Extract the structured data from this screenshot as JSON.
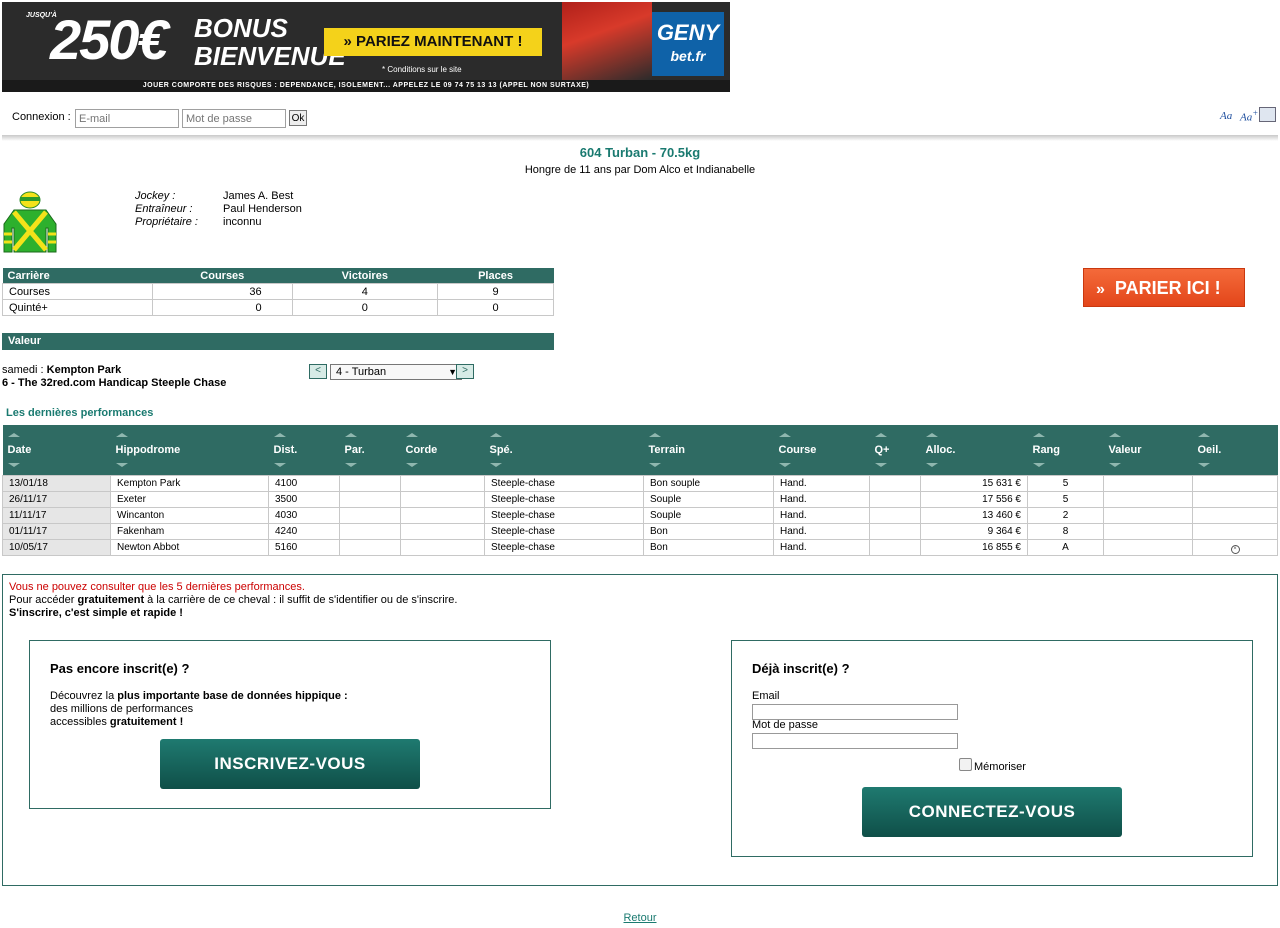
{
  "banner": {
    "prefix": "JUSQU'À",
    "amount": "250€",
    "headline": "BONUS BIENVENUE",
    "cta": "» PARIEZ MAINTENANT !",
    "conditions": "* Conditions sur le site",
    "brand_top": "GENY",
    "brand_bottom": "bet.fr",
    "footer": "JOUER COMPORTE DES RISQUES : DEPENDANCE, ISOLEMENT... APPELEZ LE 09 74 75 13 13 (APPEL NON SURTAXE)"
  },
  "login": {
    "label": "Connexion :",
    "email_placeholder": "E-mail",
    "password_placeholder": "Mot de passe",
    "ok": "Ok"
  },
  "tools": {
    "font_small": "Aa",
    "font_large": "Aa",
    "font_plus": "+"
  },
  "horse": {
    "title": "604 Turban  - 70.5kg",
    "subtitle": "Hongre de 11 ans par Dom Alco et Indianabelle"
  },
  "connections": {
    "jockey_label": "Jockey :",
    "jockey": "James A. Best",
    "trainer_label": "Entraîneur :",
    "trainer": "Paul Henderson",
    "owner_label": "Propriétaire :",
    "owner": "inconnu"
  },
  "career": {
    "headers": [
      "Carrière",
      "Courses",
      "Victoires",
      "Places"
    ],
    "rows": [
      [
        "Courses",
        "36",
        "4",
        "9"
      ],
      [
        "Quinté+",
        "0",
        "0",
        "0"
      ]
    ]
  },
  "valeur_label": "Valeur",
  "bet_button": "PARIER ICI !",
  "race": {
    "day": "samedi :",
    "venue": "Kempton Park",
    "name": "6 - The 32red.com Handicap Steeple Chase",
    "prev": "<",
    "next": ">",
    "selected_horse": "4 - Turban"
  },
  "perf": {
    "title": "Les dernières performances",
    "headers": [
      "Date",
      "Hippodrome",
      "Dist.",
      "Par.",
      "Corde",
      "Spé.",
      "Terrain",
      "Course",
      "Q+",
      "Alloc.",
      "Rang",
      "Valeur",
      "Oeil."
    ],
    "rows": [
      [
        "13/01/18",
        "Kempton Park",
        "4100",
        "",
        "",
        "Steeple-chase",
        "Bon souple",
        "Hand.",
        "",
        "15 631 €",
        "5",
        "",
        ""
      ],
      [
        "26/11/17",
        "Exeter",
        "3500",
        "",
        "",
        "Steeple-chase",
        "Souple",
        "Hand.",
        "",
        "17 556 €",
        "5",
        "",
        ""
      ],
      [
        "11/11/17",
        "Wincanton",
        "4030",
        "",
        "",
        "Steeple-chase",
        "Souple",
        "Hand.",
        "",
        "13 460 €",
        "2",
        "",
        ""
      ],
      [
        "01/11/17",
        "Fakenham",
        "4240",
        "",
        "",
        "Steeple-chase",
        "Bon",
        "Hand.",
        "",
        "9 364 €",
        "8",
        "",
        ""
      ],
      [
        "10/05/17",
        "Newton Abbot",
        "5160",
        "",
        "",
        "Steeple-chase",
        "Bon",
        "Hand.",
        "",
        "16 855 €",
        "A",
        "",
        "eye"
      ]
    ]
  },
  "register": {
    "msg1": "Vous ne pouvez consulter que les 5 dernières performances.",
    "msg2_pre": "Pour accéder ",
    "msg2_bold": "gratuitement",
    "msg2_post": " à la carrière de ce cheval : il suffit de s'identifier ou de s'inscrire.",
    "msg3": "S'inscrire, c'est simple et rapide !",
    "new_title": "Pas encore inscrit(e) ?",
    "new_line1_pre": "Découvrez la ",
    "new_line1_bold": "plus importante base de données hippique :",
    "new_line2": "des millions de performances",
    "new_line3_pre": "accessibles ",
    "new_line3_bold": "gratuitement !",
    "signup": "INSCRIVEZ-VOUS",
    "member_title": "Déjà inscrit(e) ?",
    "email_label": "Email",
    "password_label": "Mot de passe",
    "remember": "Mémoriser",
    "connect": "CONNECTEZ-VOUS"
  },
  "back": "Retour"
}
